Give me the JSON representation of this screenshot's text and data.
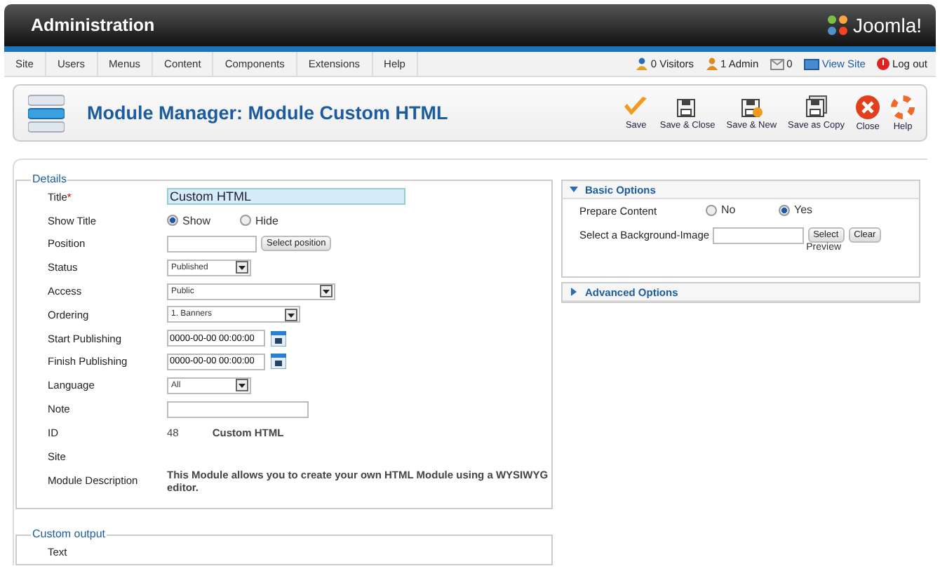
{
  "header": {
    "title": "Administration",
    "logo_text": "Joomla!"
  },
  "menu": [
    {
      "label": "Site"
    },
    {
      "label": "Users"
    },
    {
      "label": "Menus"
    },
    {
      "label": "Content"
    },
    {
      "label": "Components"
    },
    {
      "label": "Extensions"
    },
    {
      "label": "Help"
    }
  ],
  "status_links": [
    {
      "kind": "visitors",
      "label": "0 Visitors"
    },
    {
      "kind": "admin",
      "label": "1 Admin"
    },
    {
      "kind": "messages",
      "label": "0"
    },
    {
      "kind": "view-site",
      "label": "View Site"
    },
    {
      "kind": "logout",
      "label": "Log out"
    }
  ],
  "toolbar": {
    "title": "Module Manager: Module Custom HTML",
    "buttons": [
      {
        "kind": "save",
        "label": "Save"
      },
      {
        "kind": "save-close",
        "label": "Save & Close"
      },
      {
        "kind": "save-new",
        "label": "Save & New"
      },
      {
        "kind": "save-copy",
        "label": "Save as Copy"
      },
      {
        "kind": "close",
        "label": "Close"
      },
      {
        "kind": "help",
        "label": "Help"
      }
    ]
  },
  "details": {
    "legend": "Details",
    "fields": [
      {
        "kind": "text",
        "label": "Title",
        "required_mark": "*",
        "value": "Custom HTML"
      },
      {
        "kind": "radio",
        "label": "Show Title",
        "options": [
          {
            "label": "Show",
            "selected": true
          },
          {
            "label": "Hide",
            "selected": false
          }
        ]
      },
      {
        "kind": "text_button",
        "label": "Position",
        "button": "Select position"
      },
      {
        "kind": "select",
        "label": "Status",
        "value": "Published"
      },
      {
        "kind": "select",
        "label": "Access",
        "value": "Public"
      },
      {
        "kind": "select",
        "label": "Ordering",
        "value": "1. Banners"
      },
      {
        "kind": "date",
        "label": "Start Publishing",
        "value": "0000-00-00 00:00:00"
      },
      {
        "kind": "date",
        "label": "Finish Publishing",
        "value": "0000-00-00 00:00:00"
      },
      {
        "kind": "select",
        "label": "Language",
        "value": "All"
      },
      {
        "kind": "text",
        "label": "Note"
      },
      {
        "kind": "info",
        "label": "ID",
        "value": "48",
        "extra": "Custom HTML"
      },
      {
        "kind": "plain",
        "label": "Site"
      },
      {
        "kind": "description",
        "label": "Module Description",
        "value": "This Module allows you to create your own HTML Module using a WYSIWYG editor."
      }
    ]
  },
  "custom_output": {
    "legend": "Custom output",
    "fields": [
      {
        "label": "Text"
      }
    ]
  },
  "panels": [
    {
      "title": "Basic Options",
      "expanded": true,
      "fields": [
        {
          "kind": "radio",
          "label": "Prepare Content",
          "options": [
            {
              "label": "No",
              "selected": false
            },
            {
              "label": "Yes",
              "selected": true
            }
          ]
        },
        {
          "kind": "image",
          "label": "Select a Background-Image",
          "buttons": [
            "Select",
            "Clear"
          ],
          "note": "Preview"
        }
      ]
    },
    {
      "title": "Advanced Options",
      "expanded": false
    }
  ]
}
